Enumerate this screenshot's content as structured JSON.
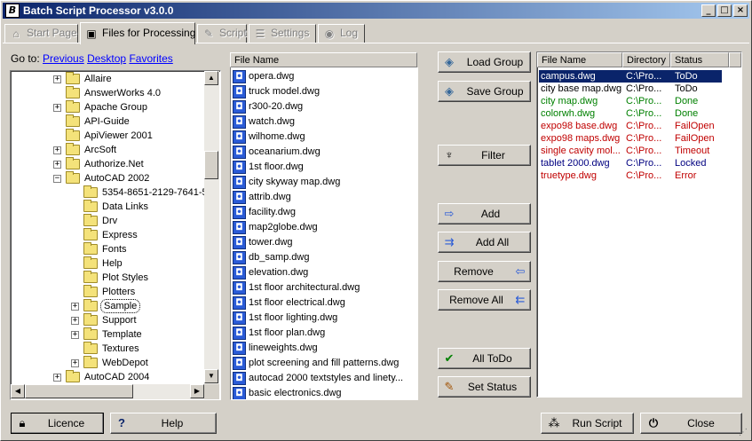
{
  "window": {
    "title": "Batch Script Processor v3.0.0",
    "controls": {
      "minimize": "_",
      "maximize": "□",
      "close": "×"
    }
  },
  "tabs": [
    {
      "label": "Start Page",
      "icon": "home-icon",
      "glyph": "⌂",
      "state": "disabled"
    },
    {
      "label": "Files for Processing",
      "icon": "floppy-icon",
      "glyph": "▣",
      "state": "active"
    },
    {
      "label": "Script",
      "icon": "script-icon",
      "glyph": "✎",
      "state": "disabled"
    },
    {
      "label": "Settings",
      "icon": "settings-icon",
      "glyph": "☰",
      "state": "disabled"
    },
    {
      "label": "Log",
      "icon": "globe-icon",
      "glyph": "◉",
      "state": "disabled"
    }
  ],
  "goto": {
    "label": "Go to:",
    "previous": "Previous",
    "desktop": "Desktop",
    "favorites": "Favorites"
  },
  "tree": [
    {
      "label": "Allaire",
      "level": 0,
      "expander": "+"
    },
    {
      "label": "AnswerWorks 4.0",
      "level": 0,
      "expander": ""
    },
    {
      "label": "Apache Group",
      "level": 0,
      "expander": "+"
    },
    {
      "label": "API-Guide",
      "level": 0,
      "expander": ""
    },
    {
      "label": "ApiViewer 2001",
      "level": 0,
      "expander": ""
    },
    {
      "label": "ArcSoft",
      "level": 0,
      "expander": "+"
    },
    {
      "label": "Authorize.Net",
      "level": 0,
      "expander": "+"
    },
    {
      "label": "AutoCAD 2002",
      "level": 0,
      "expander": "−"
    },
    {
      "label": "5354-8651-2129-7641-5",
      "level": 1,
      "expander": ""
    },
    {
      "label": "Data Links",
      "level": 1,
      "expander": ""
    },
    {
      "label": "Drv",
      "level": 1,
      "expander": ""
    },
    {
      "label": "Express",
      "level": 1,
      "expander": ""
    },
    {
      "label": "Fonts",
      "level": 1,
      "expander": ""
    },
    {
      "label": "Help",
      "level": 1,
      "expander": ""
    },
    {
      "label": "Plot Styles",
      "level": 1,
      "expander": ""
    },
    {
      "label": "Plotters",
      "level": 1,
      "expander": ""
    },
    {
      "label": "Sample",
      "level": 1,
      "expander": "+",
      "selected": true
    },
    {
      "label": "Support",
      "level": 1,
      "expander": "+"
    },
    {
      "label": "Template",
      "level": 1,
      "expander": "+"
    },
    {
      "label": "Textures",
      "level": 1,
      "expander": ""
    },
    {
      "label": "WebDepot",
      "level": 1,
      "expander": "+"
    },
    {
      "label": "AutoCAD 2004",
      "level": 0,
      "expander": "+"
    }
  ],
  "file_list": {
    "header": "File Name",
    "files": [
      "opera.dwg",
      "truck model.dwg",
      "r300-20.dwg",
      "watch.dwg",
      "wilhome.dwg",
      "oceanarium.dwg",
      "1st floor.dwg",
      "city skyway map.dwg",
      "attrib.dwg",
      "facility.dwg",
      "map2globe.dwg",
      "tower.dwg",
      "db_samp.dwg",
      "elevation.dwg",
      "1st floor architectural.dwg",
      "1st floor electrical.dwg",
      "1st floor lighting.dwg",
      "1st floor plan.dwg",
      "lineweights.dwg",
      "plot screening and fill patterns.dwg",
      "autocad 2000 textstyles and linety...",
      "basic electronics.dwg"
    ]
  },
  "buttons": {
    "load_group": "Load Group",
    "save_group": "Save Group",
    "filter": "Filter",
    "add": "Add",
    "add_all": "Add All",
    "remove": "Remove",
    "remove_all": "Remove All",
    "all_todo": "All ToDo",
    "set_status": "Set Status",
    "licence": "Licence",
    "help": "Help",
    "run_script": "Run Script",
    "close": "Close"
  },
  "status_list": {
    "headers": {
      "file": "File Name",
      "directory": "Directory",
      "status": "Status"
    },
    "rows": [
      {
        "file": "campus.dwg",
        "directory": "C:\\Pro...",
        "status": "ToDo",
        "color": "#ffffff",
        "selected": true
      },
      {
        "file": "city base map.dwg",
        "directory": "C:\\Pro...",
        "status": "ToDo",
        "color": "#000000"
      },
      {
        "file": "city map.dwg",
        "directory": "C:\\Pro...",
        "status": "Done",
        "color": "#008000"
      },
      {
        "file": "colorwh.dwg",
        "directory": "C:\\Pro...",
        "status": "Done",
        "color": "#008000"
      },
      {
        "file": "expo98 base.dwg",
        "directory": "C:\\Pro...",
        "status": "FailOpen",
        "color": "#c00000"
      },
      {
        "file": "expo98 maps.dwg",
        "directory": "C:\\Pro...",
        "status": "FailOpen",
        "color": "#c00000"
      },
      {
        "file": "single cavity mol...",
        "directory": "C:\\Pro...",
        "status": "Timeout",
        "color": "#c00000"
      },
      {
        "file": "tablet 2000.dwg",
        "directory": "C:\\Pro...",
        "status": "Locked",
        "color": "#000080"
      },
      {
        "file": "truetype.dwg",
        "directory": "C:\\Pro...",
        "status": "Error",
        "color": "#c00000"
      }
    ]
  },
  "colors": {
    "selection": "#0a246a",
    "link": "#0000ff",
    "title_gradient_start": "#0a246a",
    "title_gradient_end": "#a6caf0"
  }
}
